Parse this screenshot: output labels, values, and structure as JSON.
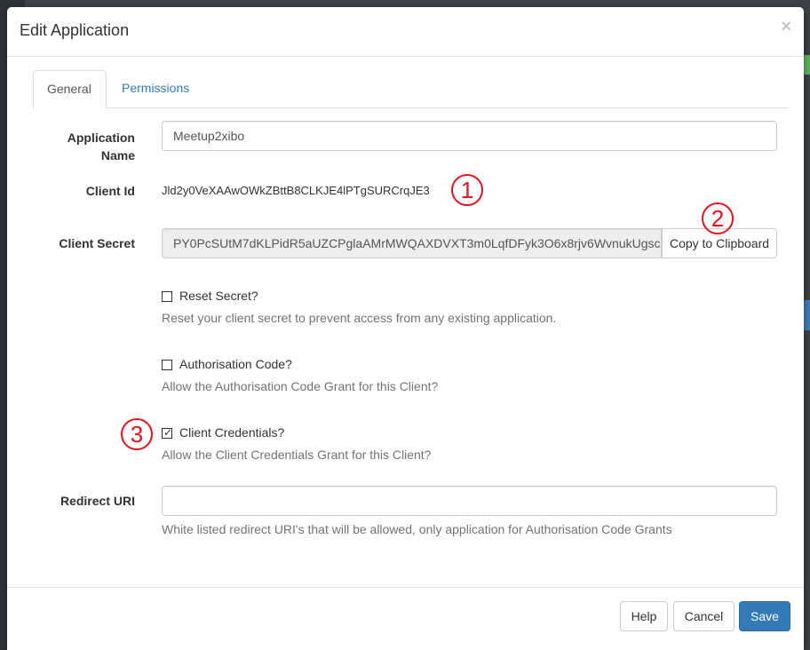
{
  "modal": {
    "title": "Edit Application",
    "close_glyph": "×"
  },
  "tabs": [
    {
      "label": "General",
      "active": true
    },
    {
      "label": "Permissions",
      "active": false
    }
  ],
  "form": {
    "app_name": {
      "label": "Application Name",
      "value": "Meetup2xibo"
    },
    "client_id": {
      "label": "Client Id",
      "value": "Jld2y0VeXAAwOWkZBttB8CLKJE4lPTgSURCrqJE3"
    },
    "client_secret": {
      "label": "Client Secret",
      "value": "PY0PcSUtM7dKLPidR5aUZCPglaAMrMWQAXDVXT3m0LqfDFyk3O6x8rjv6WvnukUgsc",
      "copy_label": "Copy to Clipboard"
    },
    "reset_secret": {
      "label": "Reset Secret?",
      "checked": false,
      "help": "Reset your client secret to prevent access from any existing application."
    },
    "auth_code": {
      "label": "Authorisation Code?",
      "checked": false,
      "help": "Allow the Authorisation Code Grant for this Client?"
    },
    "client_credentials": {
      "label": "Client Credentials?",
      "checked": true,
      "check_glyph": "✓",
      "help": "Allow the Client Credentials Grant for this Client?"
    },
    "redirect_uri": {
      "label": "Redirect URI",
      "value": "",
      "help": "White listed redirect URI's that will be allowed, only application for Authorisation Code Grants"
    }
  },
  "annotations": [
    "1",
    "2",
    "3"
  ],
  "footer": {
    "help_label": "Help",
    "cancel_label": "Cancel",
    "save_label": "Save"
  },
  "colors": {
    "primary": "#337ab7",
    "annotation": "#e0141c",
    "link": "#337ab7"
  }
}
